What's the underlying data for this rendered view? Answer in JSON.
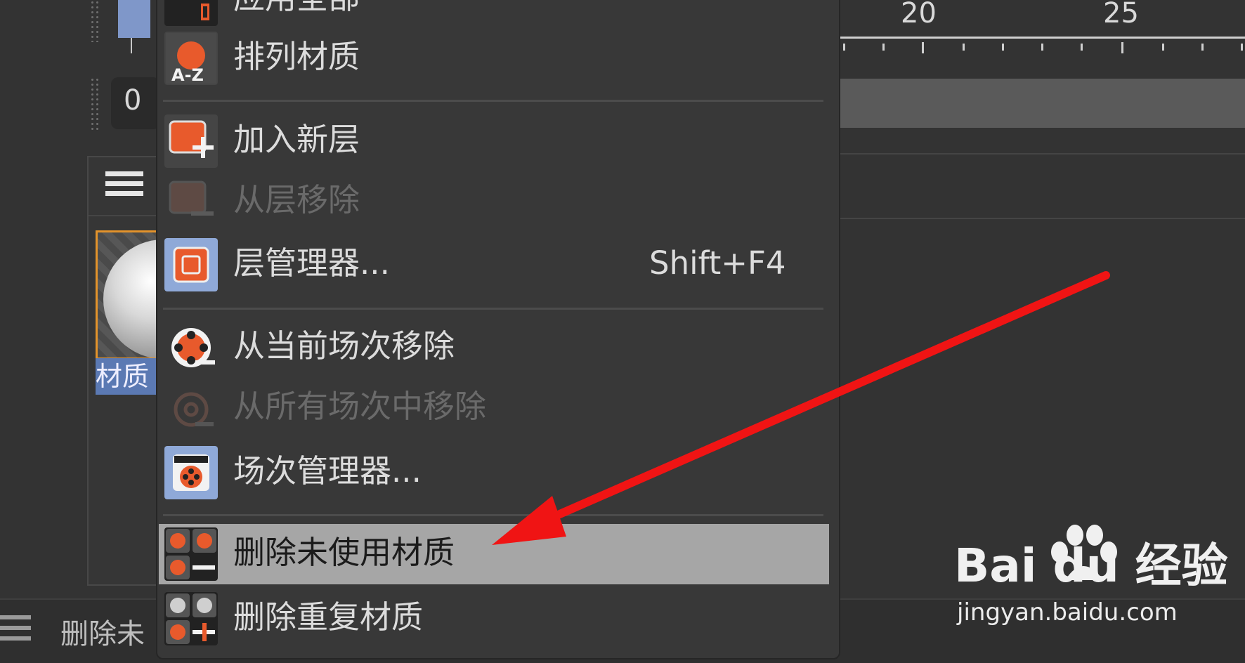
{
  "left_panel": {
    "frame_value": "0",
    "material_label": "材质"
  },
  "timeline": {
    "ticks": [
      "20",
      "25"
    ]
  },
  "context_menu": {
    "items": [
      {
        "label": "应用全部",
        "icon": "apply-all-icon",
        "disabled": false
      },
      {
        "label": "排列材质",
        "icon": "sort-az-icon",
        "disabled": false
      },
      {
        "label": "加入新层",
        "icon": "add-layer-icon",
        "disabled": false
      },
      {
        "label": "从层移除",
        "icon": "remove-layer-icon",
        "disabled": true
      },
      {
        "label": "层管理器...",
        "icon": "layer-manager-icon",
        "disabled": false,
        "shortcut": "Shift+F4"
      },
      {
        "label": "从当前场次移除",
        "icon": "remove-take-icon",
        "disabled": false
      },
      {
        "label": "从所有场次中移除",
        "icon": "remove-all-takes-icon",
        "disabled": true
      },
      {
        "label": "场次管理器...",
        "icon": "take-manager-icon",
        "disabled": false
      },
      {
        "label": "删除未使用材质",
        "icon": "delete-unused-materials-icon",
        "disabled": false,
        "highlighted": true
      },
      {
        "label": "删除重复材质",
        "icon": "delete-duplicate-materials-icon",
        "disabled": false
      }
    ]
  },
  "status_bar": {
    "text": "删除未"
  },
  "watermark": {
    "logo": "Bai du 经验",
    "url": "jingyan.baidu.com"
  },
  "colors": {
    "accent_orange": "#e85a2c",
    "highlight_row": "#a6a6a6",
    "selection_blue": "#5b79b3",
    "annotation_arrow": "#f01414"
  }
}
